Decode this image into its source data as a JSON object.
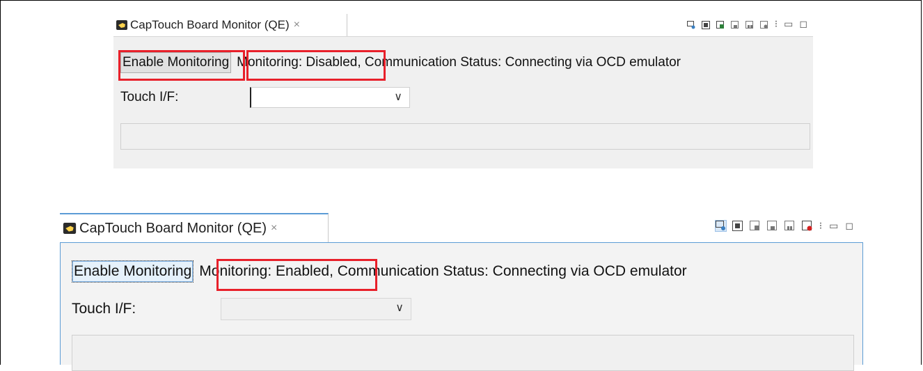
{
  "panels": [
    {
      "tab_title": "CapTouch Board Monitor (QE)",
      "close_glyph": "×",
      "enable_button": "Enable Monitoring",
      "monitoring_status": "Monitoring: Disabled",
      "communication_status": ", Communication Status: Connecting via OCD emulator",
      "touch_if_label": "Touch I/F:",
      "touch_if_value": ""
    },
    {
      "tab_title": "CapTouch Board Monitor (QE)",
      "close_glyph": "×",
      "enable_button": "Enable Monitoring",
      "monitoring_status": "Monitoring: Enabled",
      "communication_status": ", Communication Status: Connecting via OCD emulator",
      "touch_if_label": "Touch I/F:",
      "touch_if_value": ""
    }
  ],
  "toolbar_icons": [
    "monitor-refresh-icon",
    "board-icon",
    "snapshot-icon",
    "export-icon",
    "import-icon",
    "record-icon",
    "view-menu-icon",
    "minimize-icon",
    "maximize-icon"
  ],
  "colors": {
    "highlight": "#e8202a",
    "focus_blue": "#5b9bd5"
  }
}
